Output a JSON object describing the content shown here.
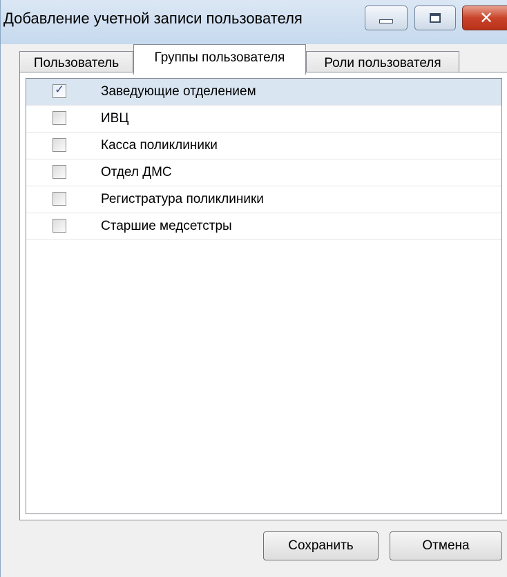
{
  "window": {
    "title": "Добавление учетной записи пользователя"
  },
  "tabs": [
    {
      "label": "Пользователь",
      "active": false
    },
    {
      "label": "Группы пользователя",
      "active": true
    },
    {
      "label": "Роли пользователя",
      "active": false
    }
  ],
  "groups": [
    {
      "label": "Заведующие отделением",
      "checked": true,
      "selected": true
    },
    {
      "label": "ИВЦ",
      "checked": false,
      "selected": false
    },
    {
      "label": "Касса поликлиники",
      "checked": false,
      "selected": false
    },
    {
      "label": "Отдел ДМС",
      "checked": false,
      "selected": false
    },
    {
      "label": "Регистратура поликлиники",
      "checked": false,
      "selected": false
    },
    {
      "label": "Старшие медсетстры",
      "checked": false,
      "selected": false
    }
  ],
  "buttons": {
    "save": "Сохранить",
    "cancel": "Отмена"
  }
}
